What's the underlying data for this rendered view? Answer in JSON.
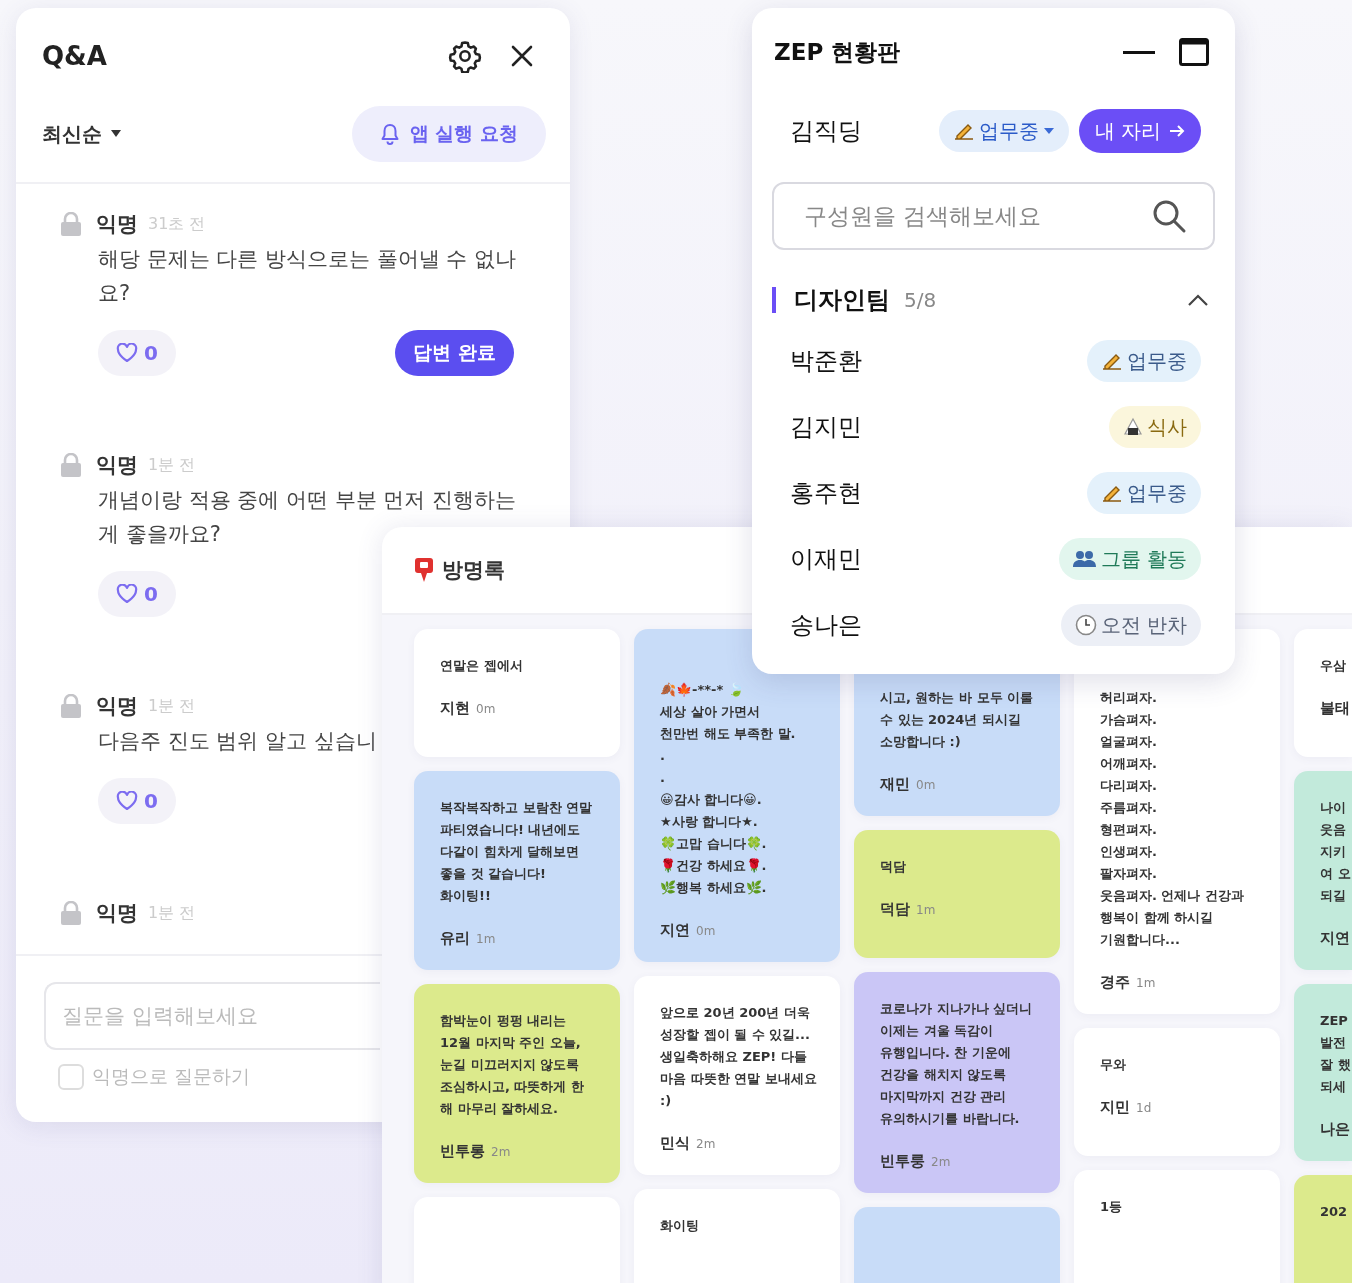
{
  "qna": {
    "title": "Q&A",
    "sort": "최신순",
    "request_button": "앱 실행 요청",
    "questions": [
      {
        "author": "익명",
        "time": "31초 전",
        "text": "해당 문제는 다른 방식으로는 풀어낼 수 없나요?",
        "likes": "0",
        "answered": true,
        "answer_button": "답변 완료"
      },
      {
        "author": "익명",
        "time": "1분 전",
        "text": "개념이랑 적용 중에 어떤 부분 먼저 진행하는 게 좋을까요?",
        "likes": "0",
        "answered": false
      },
      {
        "author": "익명",
        "time": "1분 전",
        "text": "다음주 진도 범위 알고 싶습니",
        "likes": "0",
        "answered": false
      },
      {
        "author": "익명",
        "time": "1분 전"
      }
    ],
    "input": {
      "placeholder": "질문을 입력해보세요"
    },
    "anonymous": {
      "label": "익명으로 질문하기",
      "checked": false
    }
  },
  "guestbook": {
    "title": "방명록",
    "columns": [
      [
        {
          "text": "연말은 젭에서",
          "author": "지현",
          "time": "0m",
          "color": "#ffffff"
        },
        {
          "text": "복작복작하고 보람찬 연말 파티였습니다! 내년에도 다같이 힘차게 달해보면 좋을 것 같습니다! 화이팅!!",
          "author": "유리",
          "time": "1m",
          "color": "#c8dcf8"
        },
        {
          "text": "함박눈이 펑펑 내리는 12월 마지막 주인 오늘, 눈길 미끄러지지 않도록 조심하시고, 따뜻하게 한 해 마무리 잘하세요.",
          "author": "빈투롱",
          "time": "2m",
          "color": "#dcea8c"
        },
        {
          "color": "#ffffff"
        }
      ],
      [
        {
          "text": "🍂🍁-**-* 🍃\n세상 살아 가면서\n천만번 해도 부족한 말.\n.\n.\n😀감사 합니다😀.\n★사랑 합니다★.\n🍀고맙 습니다🍀.\n🌹건강 하세요🌹.\n🌿행복 하세요🌿.",
          "author": "지연",
          "time": "0m",
          "color": "#c8dcf8"
        },
        {
          "text": "앞으로 20년 200년 더욱 성장할 젭이 될 수 있길... 생일축하해요 ZEP! 다들 마음 따뜻한 연말 보내세요 :)",
          "author": "민식",
          "time": "2m",
          "color": "#ffffff"
        },
        {
          "text": "화이팅",
          "color": "#ffffff"
        }
      ],
      [
        {
          "text": "시고, 원하는 바 모두 이룰 수 있는 2024년 되시길 소망합니다 :)",
          "author": "재민",
          "time": "0m",
          "color": "#c8dcf8"
        },
        {
          "text": "덕담",
          "author": "덕담",
          "time": "1m",
          "color": "#dcea8c"
        },
        {
          "text": "코로나가 지나가나 싶더니 이제는 겨울 독감이 유행입니다. 찬 기운에 건강을 해치지 않도록 마지막까지 건강 관리 유의하시기를 바랍니다.",
          "author": "빈투룽",
          "time": "2m",
          "color": "#cac6f6"
        },
        {
          "color": "#c8dcf8"
        }
      ],
      [
        {
          "text": "허리펴자.\n가슴펴자.\n얼굴펴자.\n어깨펴자.\n다리펴자.\n주름펴자.\n형편펴자.\n인생펴자.\n팔자펴자.\n웃음펴자. 언제나 건강과 행복이 함께 하시길 기원합니다...",
          "author": "경주",
          "time": "1m",
          "color": "#ffffff"
        },
        {
          "text": "무와",
          "author": "지민",
          "time": "1d",
          "color": "#ffffff"
        },
        {
          "text": "1등",
          "color": "#ffffff"
        }
      ],
      [
        {
          "text": "우삼",
          "author": "불태",
          "color": "#ffffff"
        },
        {
          "text": "나이\n웃음\n지키\n여 오\n되길",
          "author": "지연",
          "color": "#c2eadb"
        },
        {
          "text": "ZEP\n발전\n잘 했\n되세",
          "author": "나은",
          "color": "#c2eadb"
        },
        {
          "text": "202",
          "color": "#dcea8c"
        }
      ]
    ]
  },
  "status_board": {
    "title": "ZEP 현황판",
    "me": {
      "name": "김직딩",
      "status": "업무중",
      "kind": "working",
      "seat_button": "내 자리"
    },
    "search": {
      "placeholder": "구성원을 검색해보세요"
    },
    "group": {
      "name": "디자인팀",
      "count": "5/8",
      "expanded": true,
      "members": [
        {
          "name": "박준환",
          "status": "업무중",
          "kind": "working",
          "color": "#e4f1fb"
        },
        {
          "name": "김지민",
          "status": "식사",
          "kind": "meal",
          "color": "#fbf6dc"
        },
        {
          "name": "홍주현",
          "status": "업무중",
          "kind": "working",
          "color": "#e4f1fb"
        },
        {
          "name": "이재민",
          "status": "그룹 활동",
          "kind": "group",
          "color": "#e2f6ee"
        },
        {
          "name": "송나은",
          "status": "오전 반차",
          "kind": "halfday",
          "color": "#eceff6"
        }
      ]
    }
  }
}
